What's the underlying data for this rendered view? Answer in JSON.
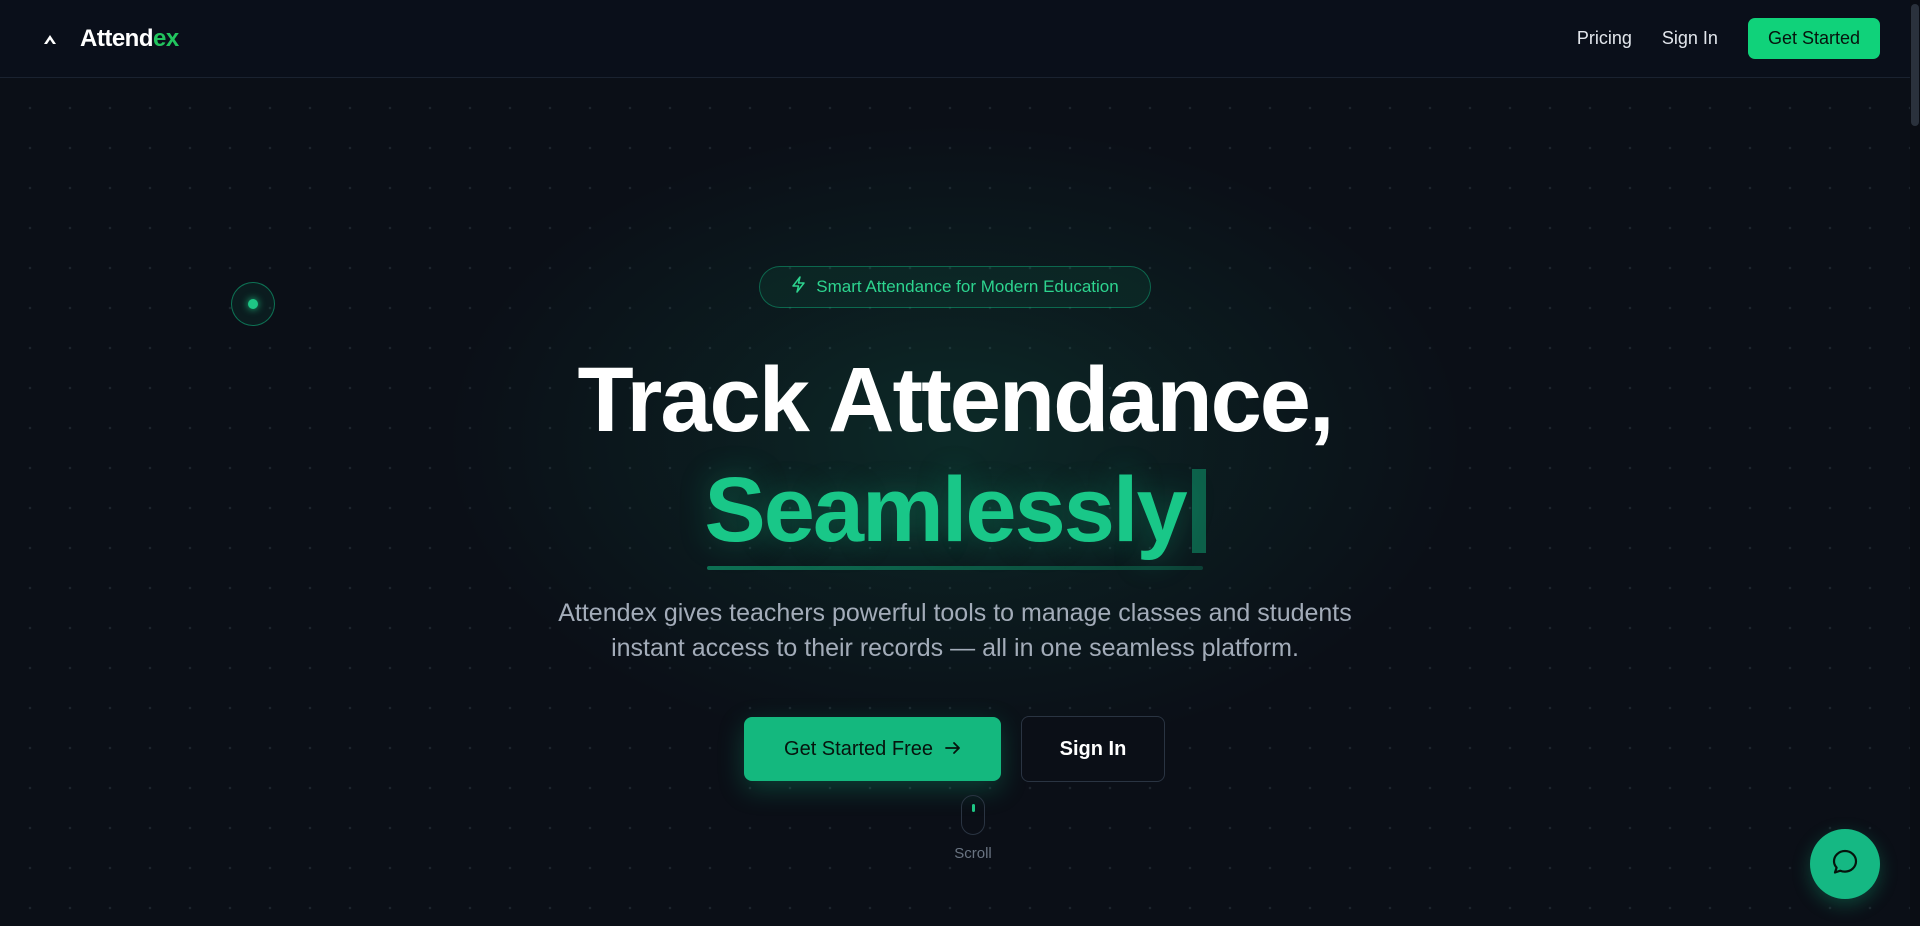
{
  "header": {
    "brand_main": "Attend",
    "brand_accent": "ex",
    "links": [
      {
        "label": "Pricing"
      },
      {
        "label": "Sign In"
      }
    ],
    "cta_label": "Get Started"
  },
  "hero": {
    "badge_text": "Smart Attendance for Modern Education",
    "headline": "Track Attendance,",
    "headline_accent": "Seamlessly",
    "subtitle_line1": "Attendex gives teachers powerful tools to manage classes and students",
    "subtitle_line2": "instant access to their records — all in one seamless platform.",
    "primary_button": "Get Started Free",
    "secondary_button": "Sign In",
    "scroll_label": "Scroll"
  },
  "colors": {
    "accent": "#10d27a",
    "background": "#0b0f17",
    "accent_text": "#19c788"
  },
  "icons": {
    "brand": "mountain-logo-icon",
    "badge": "lightning-icon",
    "primary_button": "arrow-right-icon",
    "fab": "chat-bubble-icon"
  }
}
